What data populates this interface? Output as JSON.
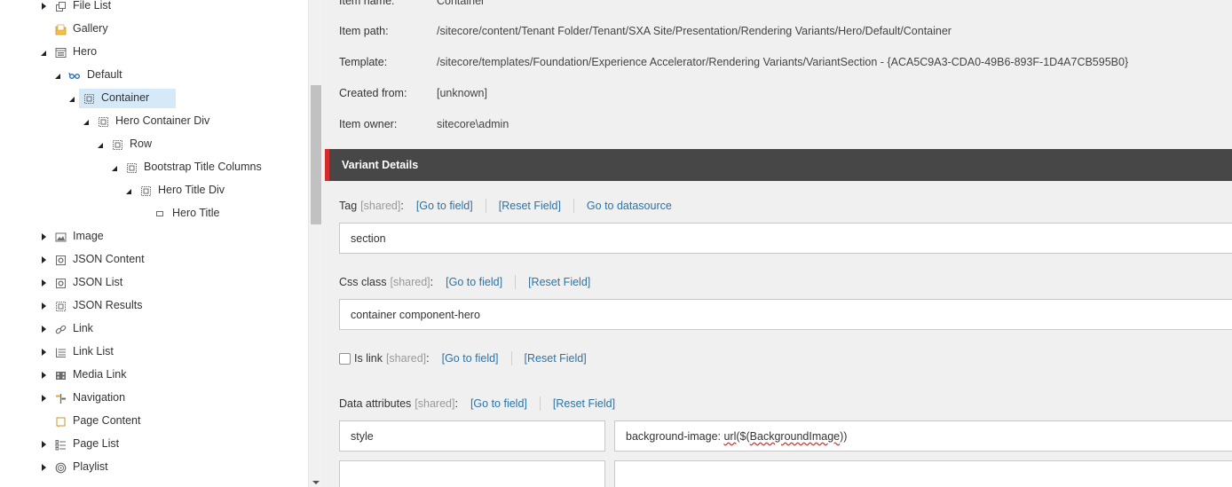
{
  "tree": {
    "items": [
      {
        "label": "File List",
        "icon": "file-list-icon",
        "arrow": "collapsed"
      },
      {
        "label": "Gallery",
        "icon": "folder-icon",
        "arrow": "none"
      },
      {
        "label": "Hero",
        "icon": "rendering-icon",
        "arrow": "expanded"
      },
      {
        "label": "Default",
        "icon": "variant-glasses-icon",
        "arrow": "expanded"
      },
      {
        "label": "Container",
        "icon": "section-icon",
        "arrow": "expanded",
        "selected": true
      },
      {
        "label": "Hero Container Div",
        "icon": "section-icon",
        "arrow": "expanded"
      },
      {
        "label": "Row",
        "icon": "section-icon",
        "arrow": "expanded"
      },
      {
        "label": "Bootstrap Title Columns",
        "icon": "section-icon",
        "arrow": "expanded"
      },
      {
        "label": "Hero Title Div",
        "icon": "section-icon",
        "arrow": "expanded"
      },
      {
        "label": "Hero Title",
        "icon": "field-icon",
        "arrow": "none"
      },
      {
        "label": "Image",
        "icon": "image-icon",
        "arrow": "collapsed"
      },
      {
        "label": "JSON Content",
        "icon": "json-icon",
        "arrow": "collapsed"
      },
      {
        "label": "JSON List",
        "icon": "json-icon",
        "arrow": "collapsed"
      },
      {
        "label": "JSON Results",
        "icon": "section-icon",
        "arrow": "collapsed"
      },
      {
        "label": "Link",
        "icon": "link-icon",
        "arrow": "collapsed"
      },
      {
        "label": "Link List",
        "icon": "list-icon",
        "arrow": "collapsed"
      },
      {
        "label": "Media Link",
        "icon": "media-icon",
        "arrow": "collapsed"
      },
      {
        "label": "Navigation",
        "icon": "navigation-icon",
        "arrow": "collapsed"
      },
      {
        "label": "Page Content",
        "icon": "page-content-icon",
        "arrow": "none"
      },
      {
        "label": "Page List",
        "icon": "page-list-icon",
        "arrow": "collapsed"
      },
      {
        "label": "Playlist",
        "icon": "playlist-icon",
        "arrow": "collapsed"
      }
    ]
  },
  "details": {
    "item_name_key": "Item name:",
    "item_name_value": "Container",
    "item_path_key": "Item path:",
    "item_path_value": "/sitecore/content/Tenant Folder/Tenant/SXA Site/Presentation/Rendering Variants/Hero/Default/Container",
    "template_key": "Template:",
    "template_value": "/sitecore/templates/Foundation/Experience Accelerator/Rendering Variants/VariantSection - {ACA5C9A3-CDA0-49B6-893F-1D4A7CB595B0}",
    "created_from_key": "Created from:",
    "created_from_value": "[unknown]",
    "owner_key": "Item owner:",
    "owner_value": "sitecore\\admin"
  },
  "section": {
    "title": "Variant Details"
  },
  "fields": {
    "shared": "[shared]",
    "go_to_field": "[Go to field]",
    "reset_field": "[Reset Field]",
    "go_to_datasource": "Go to datasource",
    "tag_label": "Tag",
    "tag_value": "section",
    "css_label": "Css class",
    "css_value": "container component-hero",
    "is_link_label": "Is link",
    "data_attr_label": "Data attributes",
    "attr_key_1": "style",
    "attr_value_1_prefix": "background-image: ",
    "attr_value_1_url": "url",
    "attr_value_1_mid": "($(",
    "attr_value_1_token": "BackgroundImage",
    "attr_value_1_suffix": "))"
  },
  "colors": {
    "accent_red": "#d72a2a",
    "header_bg": "#474747",
    "link": "#2a74a8",
    "selected_bg": "#d6e9f8"
  }
}
